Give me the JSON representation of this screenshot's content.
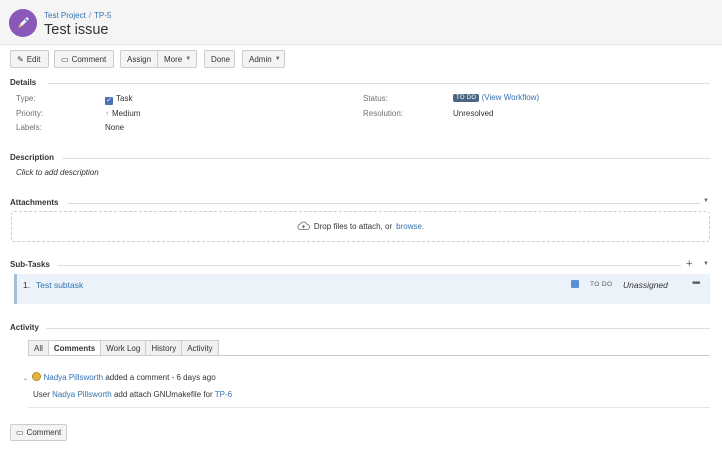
{
  "header": {
    "project": "Test Project",
    "separator": "/",
    "issue_key": "TP-5",
    "title": "Test issue"
  },
  "toolbar": {
    "edit": "Edit",
    "comment": "Comment",
    "assign": "Assign",
    "more": "More",
    "done": "Done",
    "admin": "Admin"
  },
  "details": {
    "heading": "Details",
    "type_label": "Type:",
    "type_value": "Task",
    "priority_label": "Priority:",
    "priority_value": "Medium",
    "labels_label": "Labels:",
    "labels_value": "None",
    "status_label": "Status:",
    "status_lozenge": "TO DO",
    "view_workflow": "(View Workflow)",
    "resolution_label": "Resolution:",
    "resolution_value": "Unresolved"
  },
  "description": {
    "heading": "Description",
    "placeholder": "Click to add description"
  },
  "attachments": {
    "heading": "Attachments",
    "drop_text": "Drop files to attach, or",
    "browse": "browse."
  },
  "subtasks": {
    "heading": "Sub-Tasks",
    "items": [
      {
        "num": "1.",
        "name": "Test subtask",
        "status": "TO DO",
        "assignee": "Unassigned"
      }
    ]
  },
  "activity": {
    "heading": "Activity",
    "tabs": [
      "All",
      "Comments",
      "Work Log",
      "History",
      "Activity"
    ],
    "active_tab": "Comments",
    "entry": {
      "author": "Nadya Pillsworth",
      "action": "added a comment",
      "dash": "-",
      "time": "6 days ago",
      "body_prefix": "User",
      "body_user": "Nadya Pillsworth",
      "body_mid": "add attach GNUmakefile for",
      "body_link": "TP-6"
    }
  },
  "footer": {
    "comment_button": "Comment"
  },
  "colors": {
    "link": "#3572b0",
    "lozenge": "#4a6785",
    "subtask_bg": "#ebf2f9",
    "avatar": "#8a58b8"
  }
}
